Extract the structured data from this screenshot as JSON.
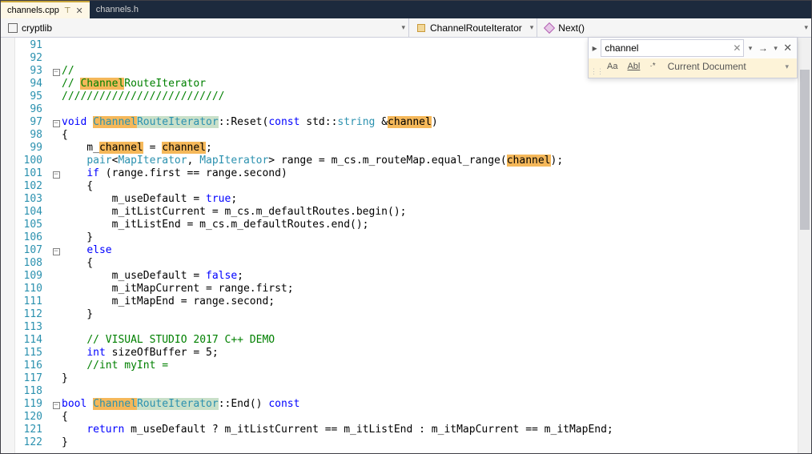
{
  "tabs": [
    {
      "label": "channels.cpp",
      "active": true
    },
    {
      "label": "channels.h",
      "active": false
    }
  ],
  "nav": {
    "project": "cryptlib",
    "class": "ChannelRouteIterator",
    "member": "Next()"
  },
  "find": {
    "value": "channel",
    "scope": "Current Document",
    "opt_case": "Aa",
    "opt_word": "Abl",
    "opt_regex": "*"
  },
  "firstLine": 91,
  "code": [
    {
      "fold": "",
      "segs": []
    },
    {
      "fold": "",
      "segs": []
    },
    {
      "fold": "-",
      "segs": [
        {
          "c": "cm",
          "t": "//"
        }
      ]
    },
    {
      "fold": "",
      "segs": [
        {
          "c": "cm",
          "t": "// "
        },
        {
          "c": "cm hl",
          "t": "Channel"
        },
        {
          "c": "cm",
          "t": "RouteIterator"
        }
      ]
    },
    {
      "fold": "",
      "segs": [
        {
          "c": "cm",
          "t": "//////////////////////////"
        }
      ]
    },
    {
      "fold": "",
      "segs": []
    },
    {
      "fold": "-",
      "segs": [
        {
          "c": "kw",
          "t": "void"
        },
        {
          "t": " "
        },
        {
          "c": "type hl",
          "t": "Channel"
        },
        {
          "c": "type hl-cur",
          "t": "RouteIterator"
        },
        {
          "t": "::Reset("
        },
        {
          "c": "kw",
          "t": "const"
        },
        {
          "t": " std::"
        },
        {
          "c": "type",
          "t": "string"
        },
        {
          "t": " &"
        },
        {
          "c": "hl",
          "t": "channel"
        },
        {
          "t": ")"
        }
      ]
    },
    {
      "fold": "",
      "segs": [
        {
          "t": "{"
        }
      ]
    },
    {
      "fold": "",
      "segs": [
        {
          "t": "    m_"
        },
        {
          "c": "hl",
          "t": "channel"
        },
        {
          "t": " = "
        },
        {
          "c": "hl",
          "t": "channel"
        },
        {
          "t": ";"
        }
      ]
    },
    {
      "fold": "",
      "segs": [
        {
          "t": "    "
        },
        {
          "c": "type",
          "t": "pair"
        },
        {
          "t": "<"
        },
        {
          "c": "type",
          "t": "MapIterator"
        },
        {
          "t": ", "
        },
        {
          "c": "type",
          "t": "MapIterator"
        },
        {
          "t": "> range = m_cs.m_routeMap.equal_range("
        },
        {
          "c": "hl",
          "t": "channel"
        },
        {
          "t": ");"
        }
      ]
    },
    {
      "fold": "-",
      "segs": [
        {
          "t": "    "
        },
        {
          "c": "kw",
          "t": "if"
        },
        {
          "t": " (range.first == range.second)"
        }
      ]
    },
    {
      "fold": "",
      "segs": [
        {
          "t": "    {"
        }
      ]
    },
    {
      "fold": "",
      "segs": [
        {
          "t": "        m_useDefault = "
        },
        {
          "c": "kw",
          "t": "true"
        },
        {
          "t": ";"
        }
      ]
    },
    {
      "fold": "",
      "segs": [
        {
          "t": "        m_itListCurrent = m_cs.m_defaultRoutes.begin();"
        }
      ]
    },
    {
      "fold": "",
      "segs": [
        {
          "t": "        m_itListEnd = m_cs.m_defaultRoutes.end();"
        }
      ]
    },
    {
      "fold": "",
      "segs": [
        {
          "t": "    }"
        }
      ]
    },
    {
      "fold": "-",
      "segs": [
        {
          "t": "    "
        },
        {
          "c": "kw",
          "t": "else"
        }
      ]
    },
    {
      "fold": "",
      "segs": [
        {
          "t": "    {"
        }
      ]
    },
    {
      "fold": "",
      "segs": [
        {
          "t": "        m_useDefault = "
        },
        {
          "c": "kw",
          "t": "false"
        },
        {
          "t": ";"
        }
      ]
    },
    {
      "fold": "",
      "segs": [
        {
          "t": "        m_itMapCurrent = range.first;"
        }
      ]
    },
    {
      "fold": "",
      "segs": [
        {
          "t": "        m_itMapEnd = range.second;"
        }
      ]
    },
    {
      "fold": "",
      "segs": [
        {
          "t": "    }"
        }
      ]
    },
    {
      "fold": "",
      "segs": []
    },
    {
      "fold": "",
      "segs": [
        {
          "t": "    "
        },
        {
          "c": "cm",
          "t": "// VISUAL STUDIO 2017 C++ DEMO"
        }
      ]
    },
    {
      "fold": "",
      "segs": [
        {
          "t": "    "
        },
        {
          "c": "kw",
          "t": "int"
        },
        {
          "t": " sizeOfBuffer = 5;"
        }
      ]
    },
    {
      "fold": "",
      "segs": [
        {
          "t": "    "
        },
        {
          "c": "cm",
          "t": "//int myInt = "
        }
      ]
    },
    {
      "fold": "",
      "segs": [
        {
          "t": "}"
        }
      ]
    },
    {
      "fold": "",
      "segs": []
    },
    {
      "fold": "-",
      "segs": [
        {
          "c": "kw",
          "t": "bool"
        },
        {
          "t": " "
        },
        {
          "c": "type hl",
          "t": "Channel"
        },
        {
          "c": "type hl-cur",
          "t": "RouteIterator"
        },
        {
          "t": "::End() "
        },
        {
          "c": "kw",
          "t": "const"
        }
      ]
    },
    {
      "fold": "",
      "segs": [
        {
          "t": "{"
        }
      ]
    },
    {
      "fold": "",
      "segs": [
        {
          "t": "    "
        },
        {
          "c": "kw",
          "t": "return"
        },
        {
          "t": " m_useDefault ? m_itListCurrent == m_itListEnd : m_itMapCurrent == m_itMapEnd;"
        }
      ]
    },
    {
      "fold": "",
      "segs": [
        {
          "t": "}"
        }
      ]
    }
  ]
}
